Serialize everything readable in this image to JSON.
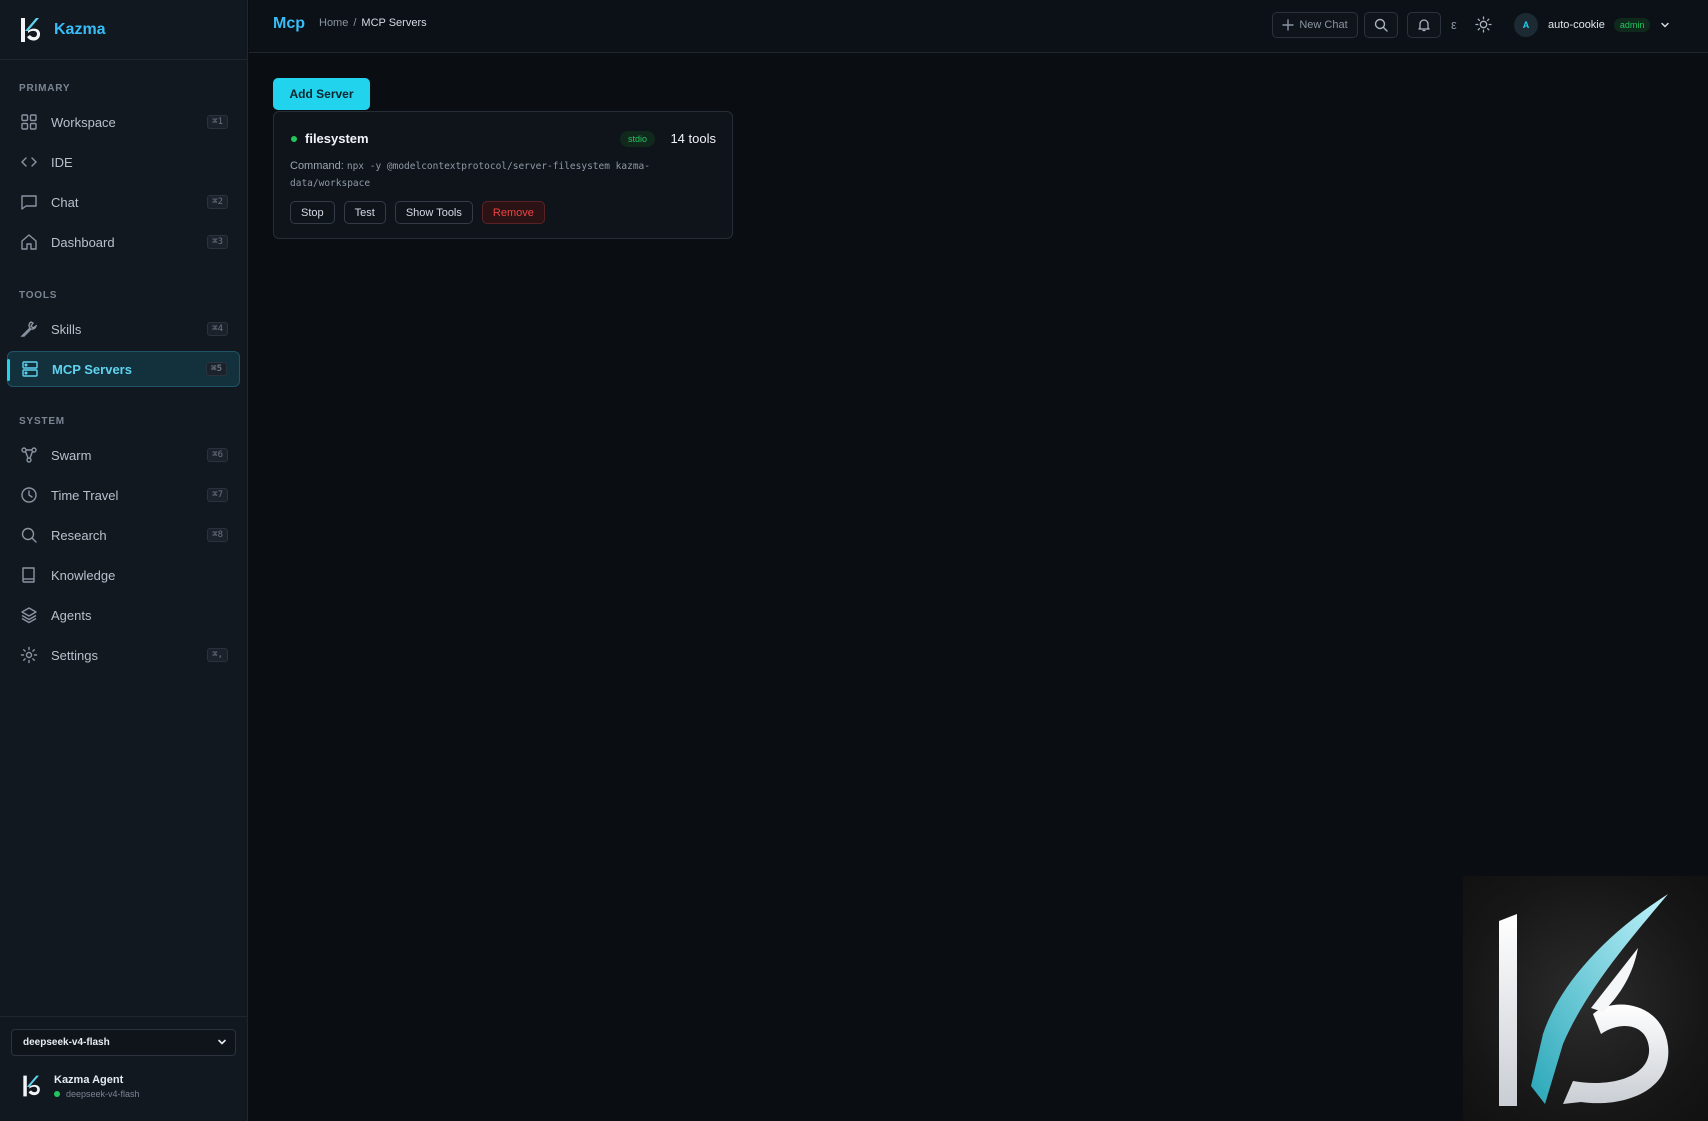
{
  "brand": {
    "name": "Kazma"
  },
  "sidebar": {
    "sections": {
      "primary": "PRIMARY",
      "tools": "TOOLS",
      "system": "SYSTEM"
    },
    "items": [
      {
        "label": "Workspace",
        "shortcut": "⌘1",
        "icon": "grid-icon"
      },
      {
        "label": "IDE",
        "shortcut": "",
        "icon": "code-icon"
      },
      {
        "label": "Chat",
        "shortcut": "⌘2",
        "icon": "chat-icon"
      },
      {
        "label": "Dashboard",
        "shortcut": "⌘3",
        "icon": "home-icon"
      },
      {
        "label": "Skills",
        "shortcut": "⌘4",
        "icon": "wrench-icon"
      },
      {
        "label": "MCP Servers",
        "shortcut": "⌘5",
        "icon": "server-icon",
        "active": true
      },
      {
        "label": "Swarm",
        "shortcut": "⌘6",
        "icon": "swarm-icon"
      },
      {
        "label": "Time Travel",
        "shortcut": "⌘7",
        "icon": "clock-icon"
      },
      {
        "label": "Research",
        "shortcut": "⌘8",
        "icon": "search-icon"
      },
      {
        "label": "Knowledge",
        "shortcut": "",
        "icon": "book-icon"
      },
      {
        "label": "Agents",
        "shortcut": "",
        "icon": "layers-icon"
      },
      {
        "label": "Settings",
        "shortcut": "⌘,",
        "icon": "gear-icon"
      }
    ],
    "model_select": {
      "value": "deepseek-v4-flash"
    },
    "agent": {
      "name": "Kazma Agent",
      "model": "deepseek-v4-flash"
    }
  },
  "header": {
    "title": "Mcp",
    "breadcrumb": {
      "home": "Home",
      "separator": "/",
      "current": "MCP Servers"
    },
    "new_chat_label": "New Chat",
    "lang_glyph": "ε",
    "user": {
      "initial": "A",
      "name": "auto-cookie",
      "role": "admin"
    }
  },
  "main": {
    "add_server_label": "Add Server",
    "server": {
      "name": "filesystem",
      "transport": "stdio",
      "tools": "14 tools",
      "command_label": "Command:",
      "command": "npx -y @modelcontextprotocol/server-filesystem kazma-data/workspace",
      "actions": {
        "stop": "Stop",
        "test": "Test",
        "show_tools": "Show Tools",
        "remove": "Remove"
      }
    }
  },
  "colors": {
    "accent": "#22d3ee",
    "brand": "#38bdf8",
    "success": "#22c55e",
    "danger": "#ef4444",
    "background": "#0a0e13"
  }
}
